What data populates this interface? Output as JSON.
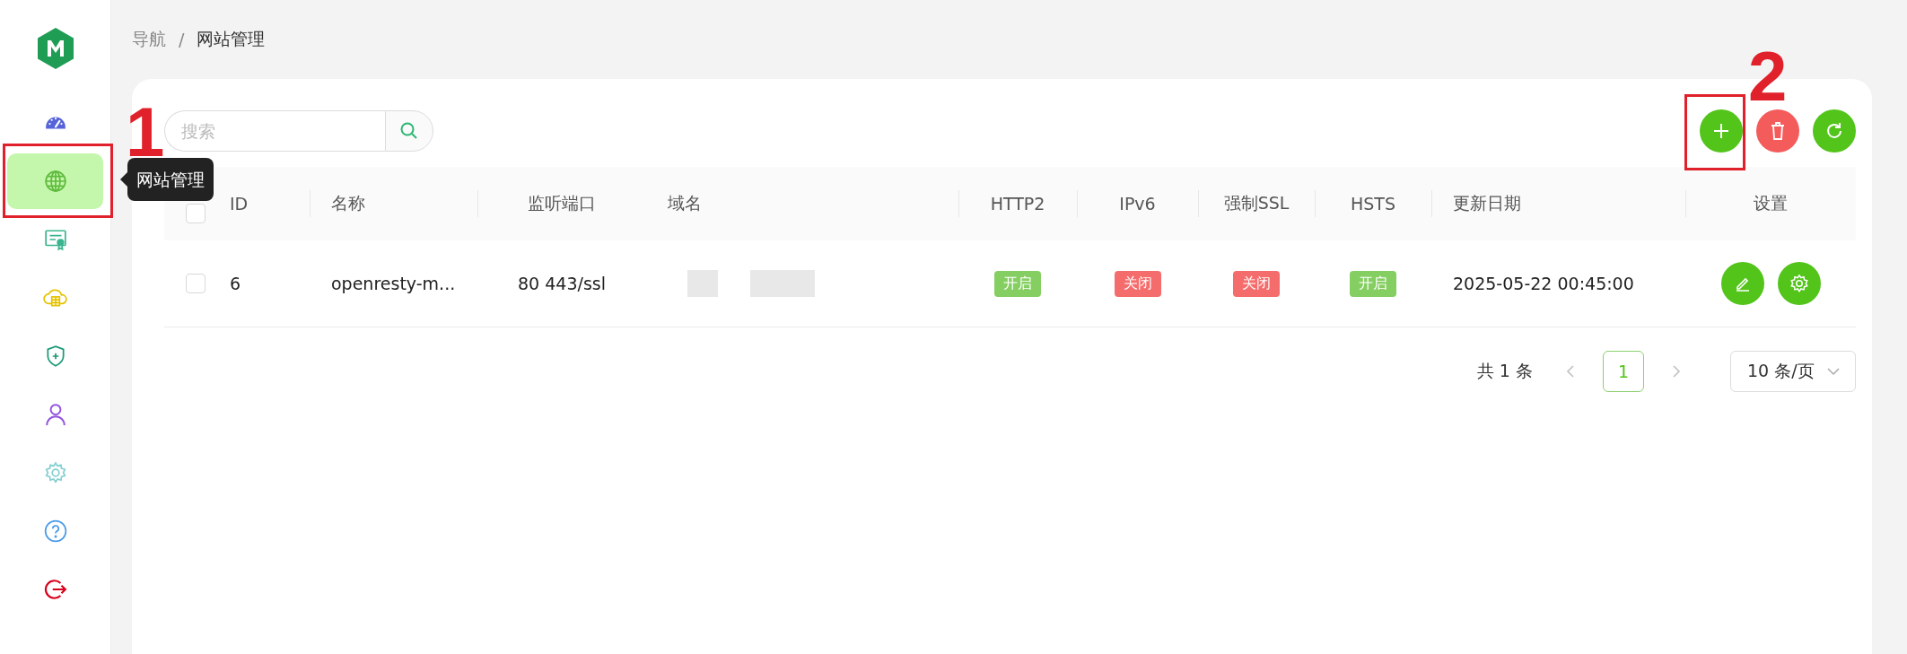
{
  "sidebar": {
    "items": [
      {
        "kind": "dashboard",
        "selected": false
      },
      {
        "kind": "globe",
        "selected": true
      },
      {
        "kind": "certificate",
        "selected": false
      },
      {
        "kind": "cloud",
        "selected": false
      },
      {
        "kind": "shield",
        "selected": false
      },
      {
        "kind": "user",
        "selected": false
      },
      {
        "kind": "gear",
        "selected": false
      },
      {
        "kind": "help",
        "selected": false
      },
      {
        "kind": "logout",
        "selected": false
      }
    ],
    "tooltip": "网站管理"
  },
  "breadcrumb": [
    "导航",
    "/",
    "网站管理"
  ],
  "search": {
    "placeholder": "搜索"
  },
  "toolbar": [
    {
      "kind": "add"
    },
    {
      "kind": "delete"
    },
    {
      "kind": "refresh"
    }
  ],
  "table": {
    "header_checked": false,
    "columns": [
      {
        "label": "ID"
      },
      {
        "label": "名称"
      },
      {
        "label": "监听端口"
      },
      {
        "label": "域名"
      },
      {
        "label": "HTTP2"
      },
      {
        "label": "IPv6"
      },
      {
        "label": "强制SSL"
      },
      {
        "label": "HSTS"
      },
      {
        "label": "更新日期"
      },
      {
        "label": "设置"
      }
    ],
    "rows": [
      {
        "checked": false,
        "id": "6",
        "name": "openresty-m...",
        "ports": "80 443/ssl",
        "domain": {
          "kind": "redacted"
        },
        "flags": [
          {
            "label": "开启",
            "on": true
          },
          {
            "label": "关闭",
            "on": false
          },
          {
            "label": "关闭",
            "on": false
          },
          {
            "label": "开启",
            "on": true
          }
        ],
        "updated": "2025-05-22 00:45:00",
        "actions": [
          {
            "kind": "edit"
          },
          {
            "kind": "settings"
          }
        ]
      }
    ]
  },
  "pagination": {
    "total": "共 1 条",
    "pages": [
      {
        "label": "1",
        "selected": true
      }
    ],
    "page_size": "10 条/页"
  },
  "annotations": [
    {
      "label": "1"
    },
    {
      "label": "2"
    }
  ]
}
